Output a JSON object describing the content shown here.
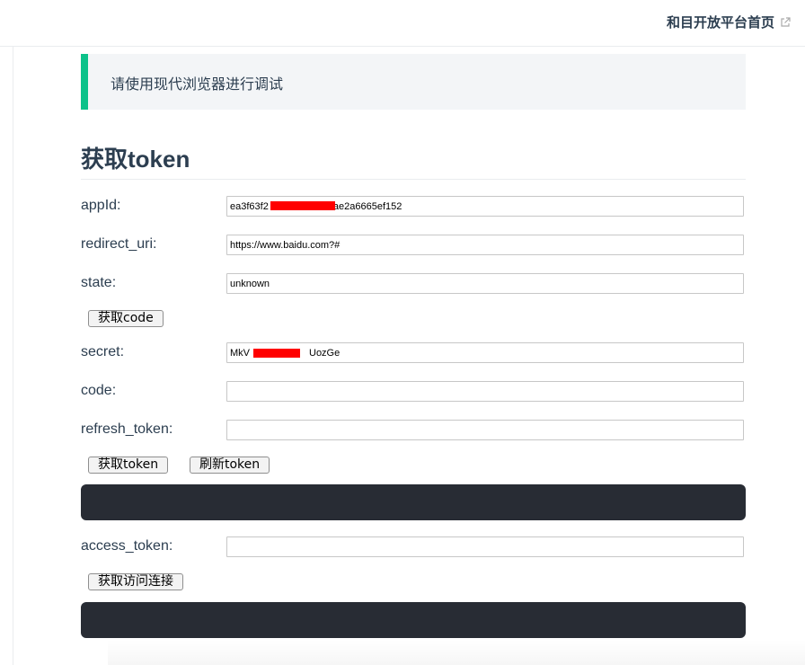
{
  "nav": {
    "home_link": "和目开放平台首页",
    "home_link_icon": "external-link-icon"
  },
  "tip": {
    "text": "请使用现代浏览器进行调试",
    "accent_color": "#0cc28a"
  },
  "section": {
    "title": "获取token"
  },
  "form": {
    "appid": {
      "label": "appId:",
      "value": "ea3f63f2      8ae2a6665ef152"
    },
    "redirect_uri": {
      "label": "redirect_uri:",
      "value": "https://www.baidu.com?#"
    },
    "state": {
      "label": "state:",
      "value": "unknown"
    },
    "get_code_button": "获取code",
    "secret": {
      "label": "secret:",
      "value": "MkV      UozGe"
    },
    "code": {
      "label": "code:",
      "value": ""
    },
    "refresh_token": {
      "label": "refresh_token:",
      "value": ""
    },
    "get_token_button": "获取token",
    "refresh_token_button": "刷新token",
    "access_token": {
      "label": "access_token:",
      "value": ""
    },
    "get_access_link_button": "获取访问连接"
  },
  "colors": {
    "code_block_bg": "#282c34",
    "redaction": "#ff0000"
  }
}
